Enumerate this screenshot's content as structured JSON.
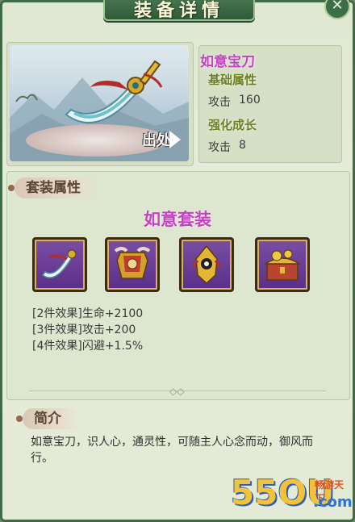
{
  "window": {
    "title": "装备详情"
  },
  "item": {
    "name": "如意宝刀",
    "source_label": "出处",
    "base_attr_title": "基础属性",
    "attack_label": "攻击",
    "attack_value": "160",
    "growth_title": "强化成长",
    "growth_label": "攻击",
    "growth_value": "8"
  },
  "set_section": {
    "tag": "套装属性",
    "set_name": "如意套装",
    "pieces": [
      {
        "icon": "sword-icon"
      },
      {
        "icon": "armor-icon"
      },
      {
        "icon": "helmet-icon"
      },
      {
        "icon": "treasure-chest-icon"
      }
    ],
    "effects": [
      "[2件效果]生命+2100",
      "[3件效果]攻击+200",
      "[4件效果]闪避+1.5%"
    ]
  },
  "intro_section": {
    "tag": "简介",
    "text": "如意宝刀，识人心，通灵性，可随主人心念而动，御风而行。"
  },
  "watermark": {
    "number": "55OU",
    "suffix": ".com",
    "brand": "畅游天下"
  },
  "colors": {
    "name_purple": "#c540c2",
    "subtitle_olive": "#6f7f24",
    "slot_purple": "#6a3e95",
    "frame_green": "#3f6a45"
  }
}
